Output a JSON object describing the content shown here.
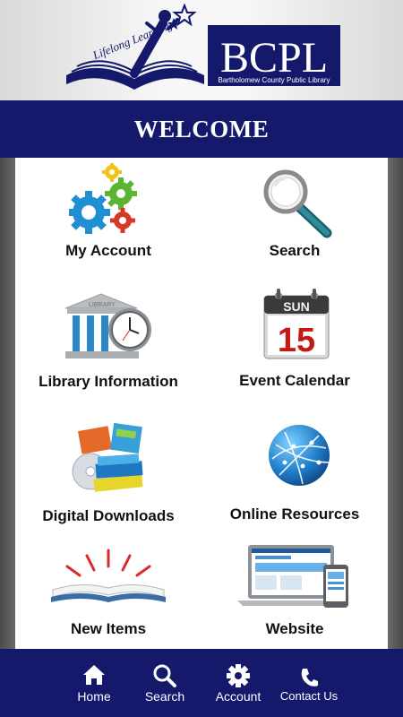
{
  "header": {
    "logo_title": "BCPL",
    "logo_subtitle": "Bartholomew County Public Library",
    "logo_tagline": "Lifelong Learning",
    "brand_color": "#14196b"
  },
  "welcome": "WELCOME",
  "tiles": [
    {
      "label": "My Account",
      "icon": "gears-icon"
    },
    {
      "label": "Search",
      "icon": "magnifier-icon"
    },
    {
      "label": "Library Information",
      "icon": "library-clock-icon"
    },
    {
      "label": "Event Calendar",
      "icon": "calendar-icon",
      "calendar_day": "SUN",
      "calendar_date": "15"
    },
    {
      "label": "Digital Downloads",
      "icon": "books-disc-icon"
    },
    {
      "label": "Online Resources",
      "icon": "globe-icon"
    },
    {
      "label": "New Items",
      "icon": "open-book-icon"
    },
    {
      "label": "Website",
      "icon": "devices-icon"
    }
  ],
  "nav": [
    {
      "label": "Home",
      "icon": "home-icon"
    },
    {
      "label": "Search",
      "icon": "search-icon"
    },
    {
      "label": "Account",
      "icon": "gear-icon"
    },
    {
      "label": "Contact Us",
      "icon": "phone-icon"
    }
  ]
}
